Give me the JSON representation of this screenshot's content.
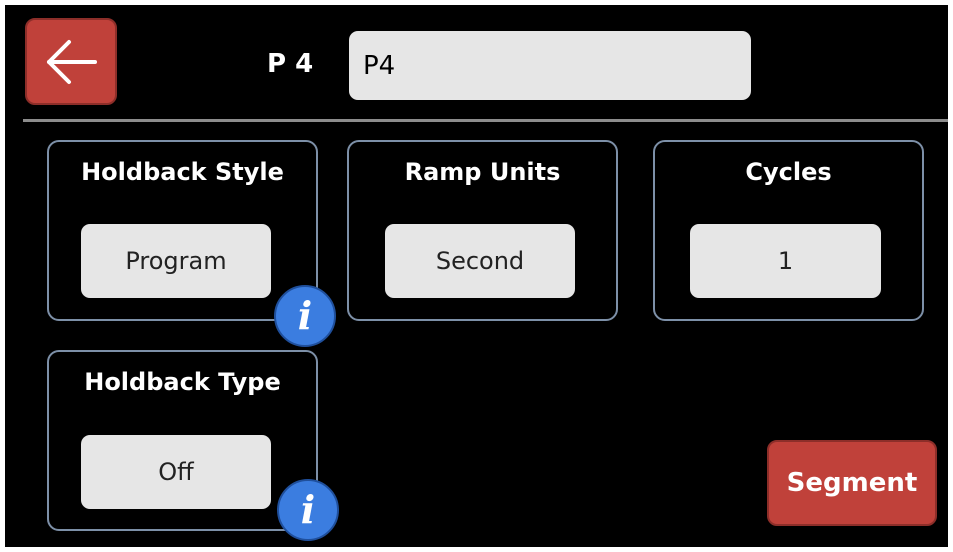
{
  "header": {
    "back_icon": "arrow-left-icon",
    "program_label": "P 4",
    "program_name_value": "P4"
  },
  "settings": {
    "holdback_style": {
      "title": "Holdback Style",
      "value": "Program",
      "info_icon": "i"
    },
    "ramp_units": {
      "title": "Ramp Units",
      "value": "Second"
    },
    "cycles": {
      "title": "Cycles",
      "value": "1"
    },
    "holdback_type": {
      "title": "Holdback Type",
      "value": "Off",
      "info_icon": "i"
    }
  },
  "footer": {
    "segment_label": "Segment"
  },
  "colors": {
    "accent_red": "#c0413a",
    "info_blue": "#3b7de0",
    "panel_border": "#7d90a8",
    "value_bg": "#e6e6e6",
    "background": "#000000"
  }
}
